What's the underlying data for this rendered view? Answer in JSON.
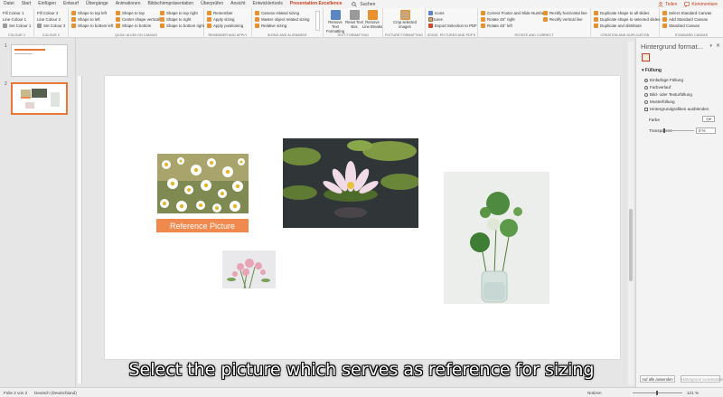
{
  "tabs": [
    "Datei",
    "Start",
    "Einfügen",
    "Entwurf",
    "Übergänge",
    "Animationen",
    "Bildschirmpräsentation",
    "Überprüfen",
    "Ansicht",
    "Entwicklertools",
    "Presentation Excellence"
  ],
  "active_tab": "Presentation Excellence",
  "search_label": "Suchen",
  "share_label": "Teilen",
  "comments_label": "Kommentare",
  "ribbon": {
    "colour1": {
      "items": [
        "Fill Colour 1",
        "Line Colour 1",
        "Set Colour 1"
      ],
      "label": "COLOUR 1"
    },
    "colour2": {
      "items": [
        "Fill Colour 2",
        "Line Colour 2",
        "Set Colour 2"
      ],
      "label": "COLOUR 2"
    },
    "align": {
      "col1": [
        "Shape to top left",
        "Shape to left",
        "Shape to bottom left"
      ],
      "col2": [
        "Shape to top",
        "Center shape vertically",
        "Shape to bottom"
      ],
      "col3": [
        "Shape to top right",
        "Shape to right",
        "Shape to bottom right"
      ],
      "label": "QUICK ALIGN ON CANVAS"
    },
    "remember": {
      "items": [
        "Remember",
        "Apply sizing",
        "Apply positioning"
      ],
      "label": "REMEMBER AND APPLY"
    },
    "sizing": {
      "items": [
        "Canvas related sizing",
        "Master object related sizing",
        "Relative sizing"
      ],
      "label": "SIZING AND ALIGNMENT"
    },
    "text": {
      "buttons": [
        "Remove Text Formatting",
        "Reset Text Box",
        "Remove Line Breaks"
      ],
      "label": "TEXT FORMATTING"
    },
    "picture": {
      "button": "Crop selected images",
      "label": "PICTURE FORMATTING"
    },
    "icons": {
      "items": [
        "Icons",
        "Pictures",
        "Export Selection to PDF"
      ],
      "label": "ICONS, PICTURES AND PDF'S"
    },
    "rotate": {
      "col1": [
        "Correct Footer and Slide Number",
        "Rotate 45° right",
        "Rotate 45° left"
      ],
      "col2": [
        "Rectify horizontal line",
        "Rectify vertical line"
      ],
      "label": "ROTATE AND CORRECT"
    },
    "creation": {
      "items": [
        "Duplicate shape to all slides",
        "Duplicate shape to selected slides",
        "Duplicate and distribute"
      ],
      "label": "CREATION AND DUPLICATION"
    },
    "canvas": {
      "items": [
        "Select Standard Canvas",
        "Add Standard Canvas",
        "Standard Canvas"
      ],
      "label": "STANDARD CANVAS"
    }
  },
  "slides": [
    {
      "number": "1"
    },
    {
      "number": "2"
    }
  ],
  "selected_slide": "2",
  "slide_content": {
    "reference_label": "Reference Picture",
    "pictures": [
      "daisies-picture",
      "water-lily-picture",
      "green-bouquet-picture",
      "pink-flowers-picture"
    ]
  },
  "caption": "Select the picture which serves as reference for sizing",
  "pane": {
    "title": "Hintergrund format...",
    "section": "Füllung",
    "options": [
      {
        "label": "Einfarbige Füllung",
        "type": "radio",
        "checked": true
      },
      {
        "label": "Farbverlauf",
        "type": "radio",
        "checked": false
      },
      {
        "label": "Bild- oder Texturfüllung",
        "type": "radio",
        "checked": false
      },
      {
        "label": "Musterfüllung",
        "type": "radio",
        "checked": false
      },
      {
        "label": "Hintergrundgrafiken ausblenden",
        "type": "checkbox",
        "checked": false
      }
    ],
    "color_label": "Farbe",
    "transparency_label": "Transparenz",
    "transparency_value": "0 %",
    "apply_all": "Auf alle anwenden",
    "reset": "Hintergrund zurücksetzen"
  },
  "status": {
    "slide": "Folie 2 von 2",
    "language": "Deutsch (Deutschland)",
    "notes": "Notizen",
    "zoom": "121 %"
  }
}
